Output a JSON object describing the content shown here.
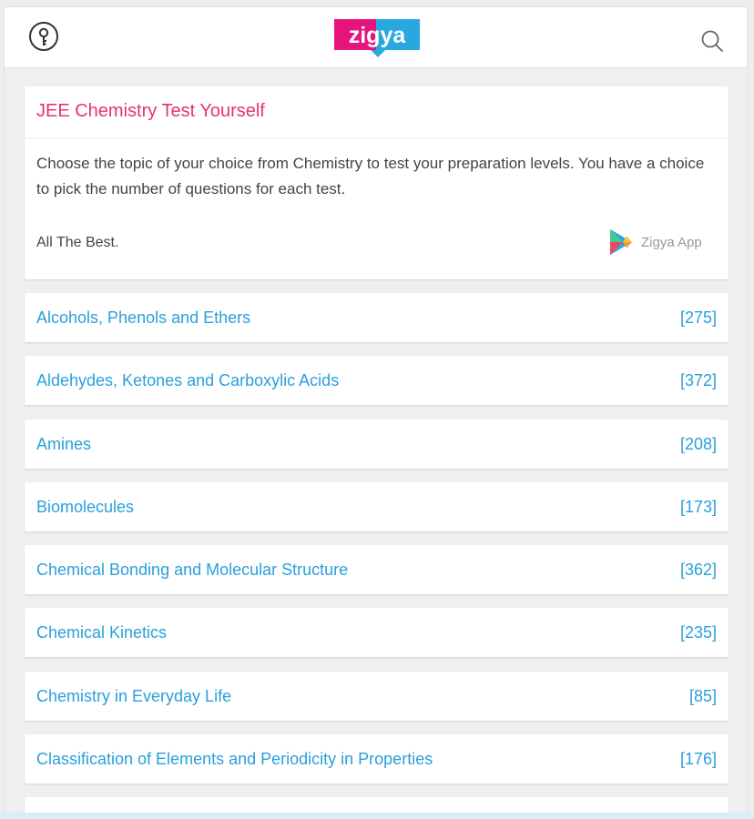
{
  "header": {
    "logo_text": "zigya",
    "logo_colors": {
      "pink": "#e6157e",
      "blue": "#29a8e0"
    },
    "left_icon": "key-icon",
    "right_icon": "search-icon"
  },
  "intro": {
    "title": "JEE Chemistry Test Yourself",
    "description": "Choose the topic of your choice from Chemistry to test your preparation levels. You have a choice to pick the number of questions for each test.",
    "closing": "All The Best.",
    "app_label": "Zigya App",
    "app_icon": "play-store-icon"
  },
  "topics": [
    {
      "name": "Alcohols, Phenols and Ethers",
      "count": "[275]"
    },
    {
      "name": "Aldehydes, Ketones and Carboxylic Acids",
      "count": "[372]"
    },
    {
      "name": "Amines",
      "count": "[208]"
    },
    {
      "name": "Biomolecules",
      "count": "[173]"
    },
    {
      "name": "Chemical Bonding and Molecular Structure",
      "count": "[362]"
    },
    {
      "name": "Chemical Kinetics",
      "count": "[235]"
    },
    {
      "name": "Chemistry in Everyday Life",
      "count": "[85]"
    },
    {
      "name": "Classification of Elements and Periodicity in Properties",
      "count": "[176]"
    }
  ],
  "colors": {
    "title_pink": "#e6317a",
    "link_blue": "#2a9fdb",
    "background": "#efefef"
  }
}
